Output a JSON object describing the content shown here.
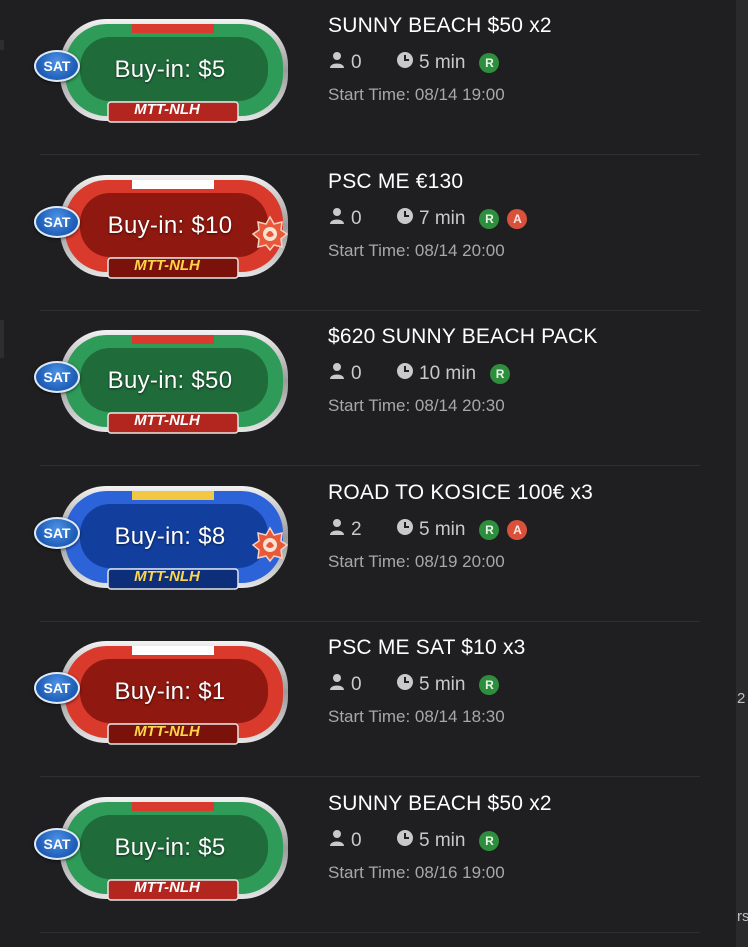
{
  "edge": {
    "t1": "2",
    "t2": "rs"
  },
  "start_prefix": "Start Time: ",
  "tournaments": [
    {
      "title": "SUNNY BEACH $50 x2",
      "type": "SAT",
      "buyin": "Buy-in: $5",
      "game": "MTT-NLH",
      "theme": "green",
      "players": "0",
      "duration": "5 min",
      "tags": [
        "R"
      ],
      "start": "Start Time: 08/14 19:00"
    },
    {
      "title": "PSC ME €130",
      "type": "SAT",
      "buyin": "Buy-in: $10",
      "game": "MTT-NLH",
      "theme": "red",
      "players": "0",
      "duration": "7 min",
      "tags": [
        "R",
        "A"
      ],
      "start": "Start Time: 08/14 20:00",
      "star_badge": true
    },
    {
      "title": "$620 SUNNY BEACH PACK",
      "type": "SAT",
      "buyin": "Buy-in: $50",
      "game": "MTT-NLH",
      "theme": "green",
      "players": "0",
      "duration": "10 min",
      "tags": [
        "R"
      ],
      "start": "Start Time: 08/14 20:30"
    },
    {
      "title": "ROAD TO KOSICE 100€ x3",
      "type": "SAT",
      "buyin": "Buy-in: $8",
      "game": "MTT-NLH",
      "theme": "blue",
      "players": "2",
      "duration": "5 min",
      "tags": [
        "R",
        "A"
      ],
      "start": "Start Time: 08/19 20:00",
      "star_badge": true
    },
    {
      "title": "PSC ME SAT $10 x3",
      "type": "SAT",
      "buyin": "Buy-in: $1",
      "game": "MTT-NLH",
      "theme": "red",
      "players": "0",
      "duration": "5 min",
      "tags": [
        "R"
      ],
      "start": "Start Time: 08/14 18:30"
    },
    {
      "title": "SUNNY BEACH $50 x2",
      "type": "SAT",
      "buyin": "Buy-in: $5",
      "game": "MTT-NLH",
      "theme": "green",
      "players": "0",
      "duration": "5 min",
      "tags": [
        "R"
      ],
      "start": "Start Time: 08/16 19:00"
    }
  ],
  "colors": {
    "green": {
      "outer": "#2f9b58",
      "inner": "#1f6b3a",
      "flag": "#d83a2e",
      "band": "#b3261f",
      "label": "#ffffff"
    },
    "red": {
      "outer": "#d93a2c",
      "inner": "#8f1810",
      "flag": "#ffffff",
      "band": "#7a120b",
      "label": "#ffd54a"
    },
    "blue": {
      "outer": "#2c63d8",
      "inner": "#123f9e",
      "flag": "#f2c744",
      "band": "#0d2f7a",
      "label": "#ffd54a"
    }
  },
  "icons": {
    "players": "person-icon",
    "clock": "clock-icon",
    "sat": "sat-badge-icon",
    "star": "flame-star-icon"
  }
}
